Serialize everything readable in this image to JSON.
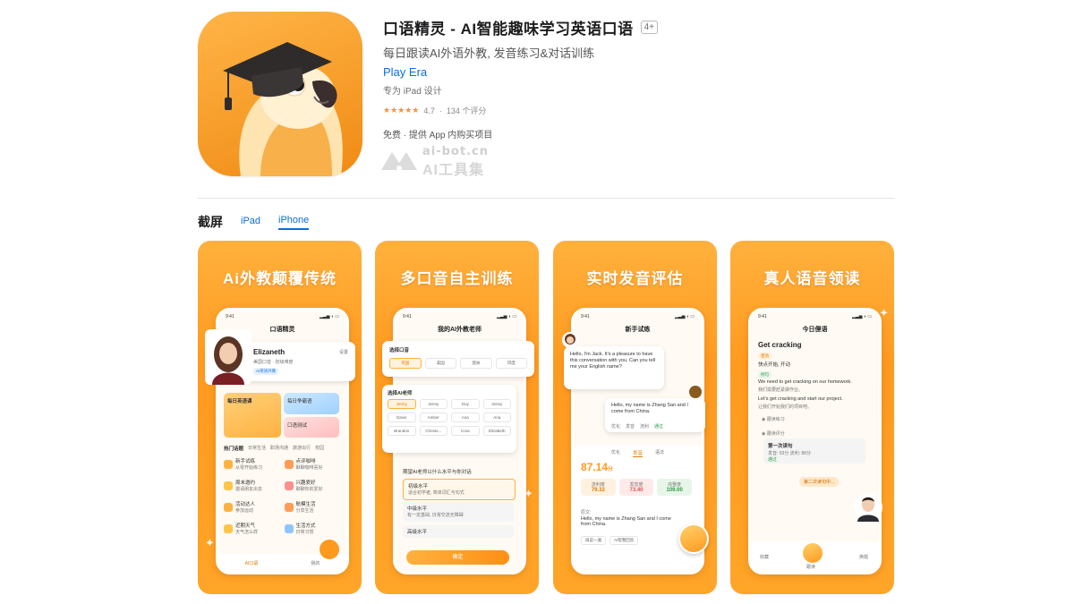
{
  "app": {
    "title": "口语精灵 - AI智能趣味学习英语口语",
    "age_rating": "4+",
    "subtitle": "每日跟读AI外语外教, 发音练习&对话训练",
    "developer": "Play Era",
    "designed_for": "专为 iPad 设计",
    "stars": "★★★★★",
    "rating": "4.7",
    "rating_count": "134 个评分",
    "price": "免费 · 提供 App 内购买项目"
  },
  "watermark": {
    "domain": "ai-bot.cn",
    "name": "AI工具集"
  },
  "screenshots": {
    "title": "截屏",
    "tabs": [
      {
        "label": "iPad",
        "active": false
      },
      {
        "label": "iPhone",
        "active": true
      }
    ]
  },
  "cards": [
    {
      "headline": "Ai外教颠覆传统",
      "phone_title": "口语精灵",
      "teacher_name": "Elizaneth",
      "teacher_meta1": "美国口音",
      "teacher_meta2": "初级难度",
      "teacher_tag": "AI英语外教",
      "settings": "设置",
      "tile1": "每日英语课",
      "tile2": "每日争霸语",
      "tile3": "口语测试",
      "tabs": [
        "热门话题",
        "日常生活",
        "职场沟通",
        "旅游出行",
        "校园"
      ],
      "items": [
        {
          "title": "新手试练",
          "desc": "从零开始练习"
        },
        {
          "title": "点评咖啡",
          "desc": "聊聊咖啡喜好"
        },
        {
          "title": "周末邀约",
          "desc": "邀请朋友出去"
        },
        {
          "title": "兴趣爱好",
          "desc": "聊聊你的爱好"
        },
        {
          "title": "活动达人",
          "desc": "参加运动"
        },
        {
          "title": "航模生活",
          "desc": "分享生活"
        },
        {
          "title": "近期天气",
          "desc": "天气怎么样"
        },
        {
          "title": "生活方式",
          "desc": "日常习惯"
        }
      ],
      "nav": [
        "AI口语",
        "我的"
      ]
    },
    {
      "headline": "多口音自主训练",
      "phone_title": "我的AI外教老师",
      "accent_label": "选择口音",
      "accents": [
        "英国",
        "美国",
        "澳洲",
        "印度"
      ],
      "teacher_label": "选择AI老师",
      "teachers": [
        "Jenny",
        "Jenny",
        "Guy",
        "Jenny",
        "Davis",
        "Amber",
        "Ana",
        "Aria",
        "Brandon",
        "Christo...",
        "Cora",
        "Elizabeth"
      ],
      "level_label": "期望AI老师以什么水平与你对话",
      "levels": [
        {
          "name": "初级水平",
          "desc": "适合初学者, 简单词汇与句式"
        },
        {
          "name": "中级水平",
          "desc": "有一定基础, 日常交流无障碍"
        },
        {
          "name": "高级水平",
          "desc": "流利表达"
        }
      ],
      "confirm": "确定"
    },
    {
      "headline": "实时发音评估",
      "phone_title": "新手试练",
      "ai_msg": "Hello, I'm Jack. It's a pleasure to have this conversation with you. Can you tell me your English name?",
      "user_msg": "Hello, my name is Zhang San and I come from China.",
      "optimize": "优化",
      "pronounce": "发音",
      "fluency": "流利",
      "pass": "通过",
      "tabs": [
        "优化",
        "发音",
        "语法"
      ],
      "score": "87.14",
      "score_unit": "分",
      "metrics": [
        {
          "label": "流利度",
          "value": "79.32"
        },
        {
          "label": "发音度",
          "value": "73.40"
        },
        {
          "label": "完整度",
          "value": "109.00"
        }
      ],
      "bottom_label": "原文:",
      "bottom_text": "Hello, my name is Zhang San and I come from China.",
      "pills": [
        "再说一遍",
        "AI帮我回答"
      ]
    },
    {
      "headline": "真人语音领读",
      "phone_title": "今日俚语",
      "word": "Get cracking",
      "badge": "俚语",
      "meaning": "快点开始, 开动",
      "example_tag": "例句",
      "ex1_en": "We need to get cracking on our homework.",
      "ex1_cn": "我们需要赶紧做作业。",
      "ex2_en": "Let's get cracking and start our project.",
      "ex2_cn": "让我们开始我们的项目吧。",
      "practice1": "跟读练习",
      "practice2": "跟读评分",
      "attempt_title": "第一次读句",
      "attempt_detail": "发音: 93分  流利: 88分",
      "attempt_status": "通过",
      "second": "第二次读句中...",
      "nav": [
        "收藏",
        "跟读",
        "换题"
      ]
    }
  ],
  "colors": {
    "accent_blue": "#0a6fd6",
    "orange": "#ff9a1f",
    "star": "#f09a1a"
  }
}
